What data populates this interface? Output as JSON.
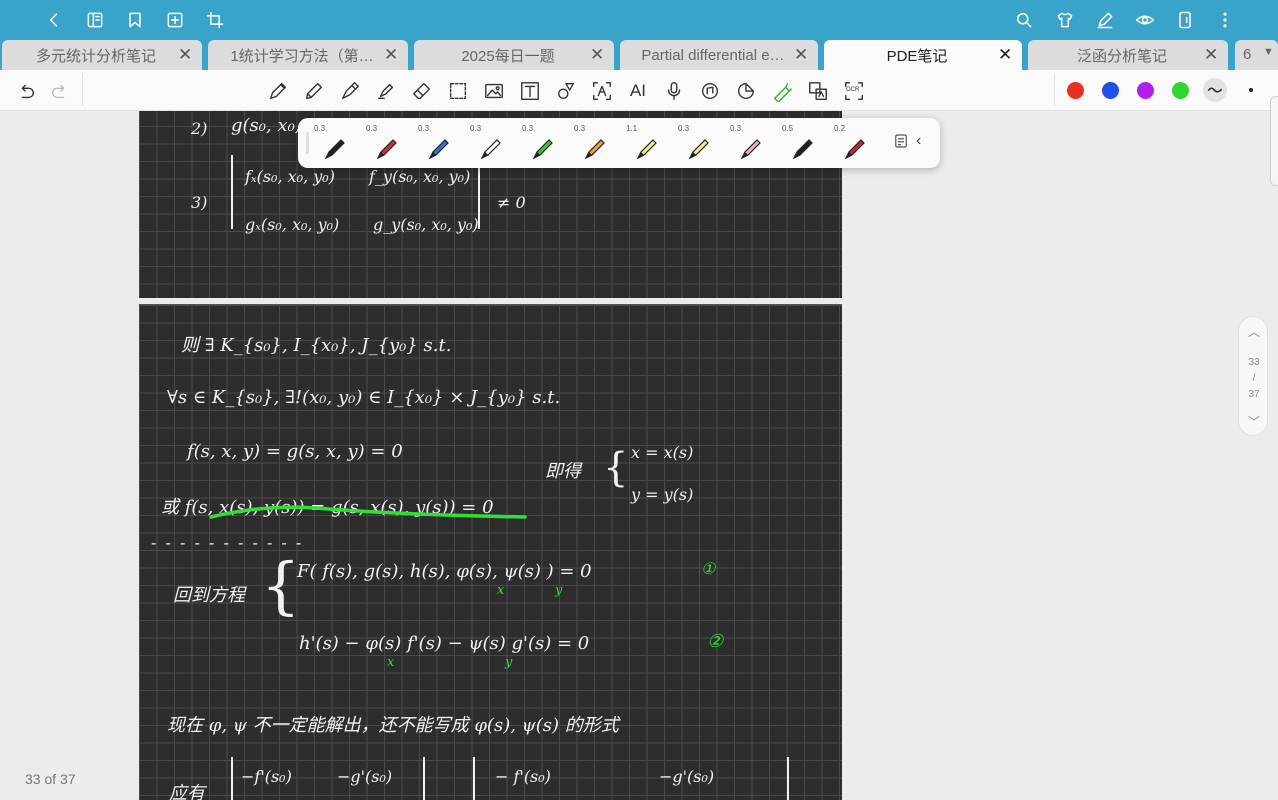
{
  "topbar": {
    "left_icons": [
      "back-icon",
      "book-icon",
      "bookmark-icon",
      "add-page-icon",
      "crop-icon"
    ],
    "right_icons": [
      "search-icon",
      "shirt-icon",
      "pen-mode-icon",
      "eye-icon",
      "phone-icon",
      "more-icon"
    ]
  },
  "tabs": [
    {
      "label": "多元统计分析笔记",
      "active": false
    },
    {
      "label": "1统计学习方法（第…",
      "active": false
    },
    {
      "label": "2025每日一题",
      "active": false
    },
    {
      "label": "Partial differential e…",
      "active": false
    },
    {
      "label": "PDE笔记",
      "active": true
    },
    {
      "label": "泛函分析笔记",
      "active": false
    },
    {
      "label": "6",
      "active": false
    }
  ],
  "toolbar": {
    "tools": [
      "pen-icon",
      "pencil-icon",
      "fountain-pen-icon",
      "highlighter-icon",
      "eraser-icon",
      "lasso-select-icon",
      "image-icon",
      "text-box-icon",
      "shape-icon",
      "text-recognize-icon",
      "ai-icon",
      "microphone-icon",
      "audio-note-icon",
      "sticker-icon",
      "laser-pen-icon",
      "translate-icon",
      "ocr-icon"
    ],
    "ai_label": "AI",
    "ocr_label": "OCR",
    "colors": [
      "#e8311f",
      "#1e4fe8",
      "#b11ee8",
      "#31d62e"
    ]
  },
  "pens": [
    {
      "size": "0.3",
      "color": "#222222"
    },
    {
      "size": "0.3",
      "color": "#d32f2f"
    },
    {
      "size": "0.3",
      "color": "#2f6fd3"
    },
    {
      "size": "0.3",
      "color": "#ffffff"
    },
    {
      "size": "0.3",
      "color": "#2ecc2e"
    },
    {
      "size": "0.3",
      "color": "#f0a030"
    },
    {
      "size": "1.1",
      "color": "#f3ef7a"
    },
    {
      "size": "0.3",
      "color": "#f3ef7a"
    },
    {
      "size": "0.3",
      "color": "#f1a8d0"
    },
    {
      "size": "0.5",
      "color": "#222222"
    },
    {
      "size": "0.2",
      "color": "#c62828"
    }
  ],
  "page1": {
    "l2": "2)",
    "l2_text": "g(s₀, x₀,",
    "l3": "3)",
    "det_fx": "fₓ(s₀, x₀, y₀)",
    "det_fy": "f_y(s₀, x₀, y₀)",
    "det_gx": "gₓ(s₀, x₀, y₀)",
    "det_gy": "g_y(s₀, x₀, y₀)",
    "neq": "≠ 0"
  },
  "page2": {
    "line1": "则 ∃ K_{s₀},  I_{x₀},  J_{y₀}     s.t.",
    "line2": "∀s ∈ K_{s₀},   ∃!(x₀, y₀) ∈ I_{x₀} × J_{y₀}     s.t.",
    "line3": "f(s, x, y) = g(s, x, y) = 0",
    "line4": "或 f(s, x(s), y(s)) = g(s, x(s), y(s)) = 0",
    "jide": "即得",
    "sys1": "x = x(s)",
    "sys2": "y = y(s)",
    "dashes": "- - - -   -   -   -   -   -   -   -",
    "huidao": "回到方程",
    "eq1": "F( f(s), g(s), h(s), φ(s), ψ(s) ) = 0",
    "eq1_x": "x",
    "eq1_y": "y",
    "eq1_num": "①",
    "eq2": "h'(s) − φ(s) f'(s) − ψ(s) g'(s) = 0",
    "eq2_x": "x",
    "eq2_y": "y",
    "eq2_num": "②",
    "line_note": "现在 φ, ψ 不一定能解出，还不能写成 φ(s), ψ(s) 的形式",
    "yingyou": "应有",
    "m1": "−f'(s₀)",
    "m2": "−g'(s₀)",
    "m3": "− f'(s₀)",
    "m4": "−g'(s₀)"
  },
  "pager": {
    "current": "33",
    "sep": "/",
    "total": "37",
    "label": "33 of 37"
  }
}
